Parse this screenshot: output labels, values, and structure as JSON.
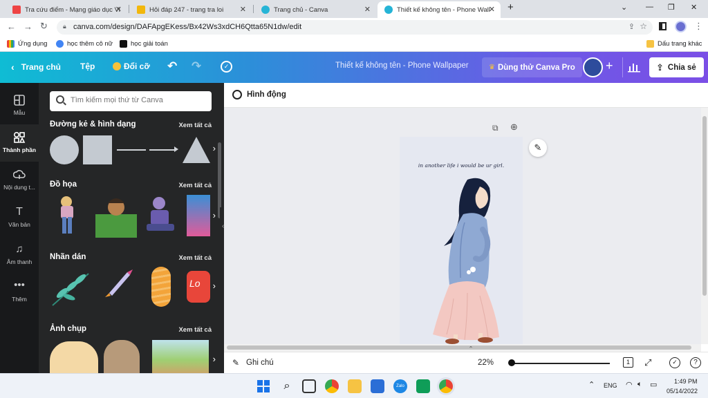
{
  "browser": {
    "tabs": [
      {
        "title": "Tra cứu điểm - Mạng giáo dục Vi"
      },
      {
        "title": "Hỏi đáp 247 - trang tra loi"
      },
      {
        "title": "Trang chủ - Canva"
      },
      {
        "title": "Thiết kế không tên - Phone Wall"
      }
    ],
    "url": "canva.com/design/DAFApgEKess/Bx42Ws3xdCH6Qtta65N1dw/edit",
    "bookmarks": [
      "Ứng dụng",
      "học thêm cô nữ",
      "học giải toán"
    ],
    "other_bookmarks": "Dấu trang khác"
  },
  "header": {
    "home": "Trang chủ",
    "file": "Tệp",
    "resize": "Đổi cỡ",
    "title": "Thiết kế không tên - Phone Wallpaper",
    "pro": "Dùng thử Canva Pro",
    "share": "Chia sẻ"
  },
  "rail": [
    {
      "label": "Mẫu"
    },
    {
      "label": "Thành phần"
    },
    {
      "label": "Nội dung t..."
    },
    {
      "label": "Văn bản"
    },
    {
      "label": "Âm thanh"
    },
    {
      "label": "Thêm"
    }
  ],
  "panel": {
    "search_placeholder": "Tìm kiếm mọi thứ từ Canva",
    "see_all": "Xem tất cả",
    "sections": [
      "Đường kẻ & hình dạng",
      "Đồ họa",
      "Nhãn dán",
      "Ảnh chụp"
    ]
  },
  "canvas": {
    "animate": "Hình động",
    "design_text": "in another life i would be ur girl.",
    "notes": "Ghi chú",
    "zoom": "22%",
    "page_count": "1",
    "zoom_level": 0.22
  },
  "taskbar": {
    "lang": "ENG",
    "time": "1:49 PM",
    "date": "05/14/2022"
  },
  "colors": {
    "canva_header_start": "#0fbcd4",
    "canva_header_end": "#7b4fe6",
    "rail_bg": "#18191b",
    "panel_bg": "#252627"
  }
}
